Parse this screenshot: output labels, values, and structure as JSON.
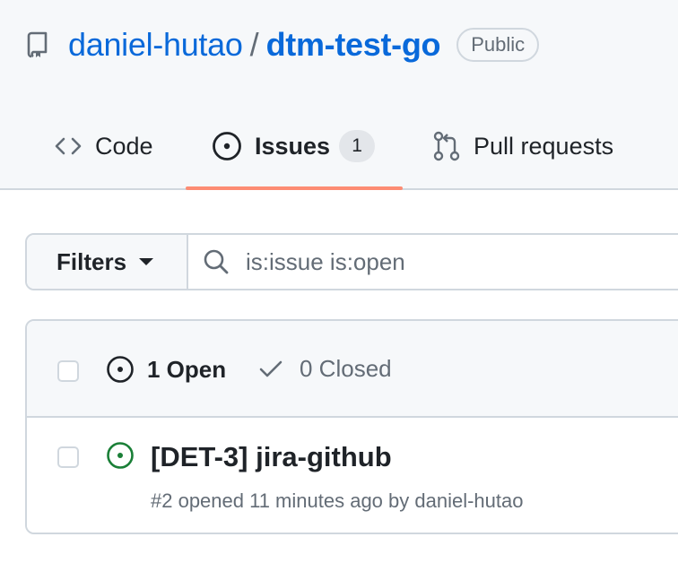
{
  "repo": {
    "owner": "daniel-hutao",
    "separator": "/",
    "name": "dtm-test-go",
    "visibility": "Public",
    "icon": "repo-icon"
  },
  "tabs": [
    {
      "label": "Code",
      "icon": "code-icon",
      "selected": false
    },
    {
      "label": "Issues",
      "icon": "issue-opened-icon",
      "count": "1",
      "selected": true
    },
    {
      "label": "Pull requests",
      "icon": "git-pull-request-icon",
      "selected": false
    }
  ],
  "filters": {
    "button_label": "Filters",
    "search_value": "is:issue is:open"
  },
  "issues_header": {
    "open_label": "1 Open",
    "closed_label": "0 Closed"
  },
  "issues": [
    {
      "title": "[DET-3] jira-github",
      "meta": "#2 opened 11 minutes ago by daniel-hutao",
      "state": "open"
    }
  ],
  "colors": {
    "link": "#0969da",
    "open_green": "#1a7f37",
    "tab_underline": "#fd8c73",
    "muted": "#636c76",
    "border": "#d0d7de"
  }
}
